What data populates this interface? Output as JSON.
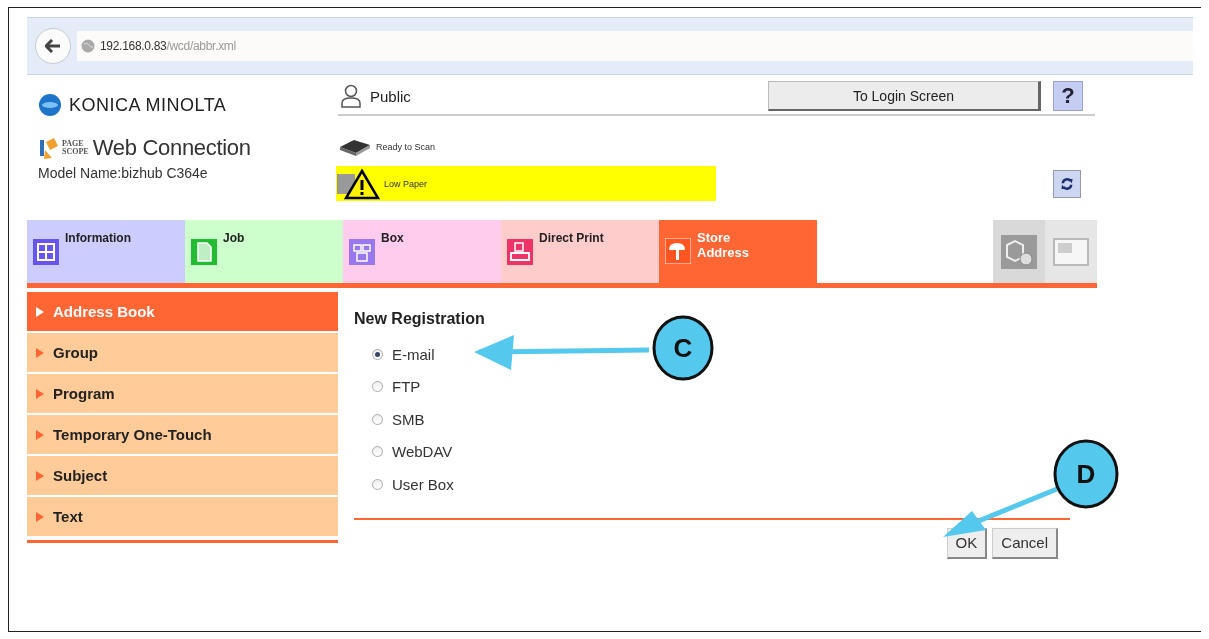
{
  "browser": {
    "url_host": "192.168.0.83",
    "url_path": "/wcd/abbr.xml"
  },
  "header": {
    "brand": "KONICA MINOLTA",
    "product_mark": [
      "PAGE",
      "SCOPE"
    ],
    "product": "Web Connection",
    "model": "Model Name:bizhub C364e",
    "user": "Public",
    "login_button": "To Login Screen",
    "help_button": "?",
    "scanner_status": "Ready to Scan",
    "alert": "Low Paper"
  },
  "tabs": [
    {
      "label": "Information",
      "kind": "info",
      "selected": false,
      "color": "#ccccff"
    },
    {
      "label": "Job",
      "kind": "job",
      "selected": false,
      "color": "#ccffcc"
    },
    {
      "label": "Box",
      "kind": "box",
      "selected": false,
      "color": "#ffccee"
    },
    {
      "label": "Direct Print",
      "kind": "print",
      "selected": false,
      "color": "#ffcccc"
    },
    {
      "label": "Store Address",
      "kind": "address",
      "selected": true,
      "color": "#ff6633"
    }
  ],
  "icon_tabs": [
    {
      "kind": "gear-box",
      "disabled": false
    },
    {
      "kind": "panel",
      "disabled": true
    }
  ],
  "sidebar": {
    "items": [
      {
        "label": "Address Book",
        "selected": true
      },
      {
        "label": "Group",
        "selected": false
      },
      {
        "label": "Program",
        "selected": false
      },
      {
        "label": "Temporary One-Touch",
        "selected": false
      },
      {
        "label": "Subject",
        "selected": false
      },
      {
        "label": "Text",
        "selected": false
      }
    ]
  },
  "form": {
    "title": "New Registration",
    "options": [
      {
        "label": "E-mail",
        "selected": true
      },
      {
        "label": "FTP",
        "selected": false
      },
      {
        "label": "SMB",
        "selected": false
      },
      {
        "label": "WebDAV",
        "selected": false
      },
      {
        "label": "User Box",
        "selected": false
      }
    ],
    "buttons": [
      "OK",
      "Cancel"
    ]
  },
  "callouts": [
    {
      "letter": "C",
      "kind": "option"
    },
    {
      "letter": "D",
      "kind": "button"
    }
  ]
}
